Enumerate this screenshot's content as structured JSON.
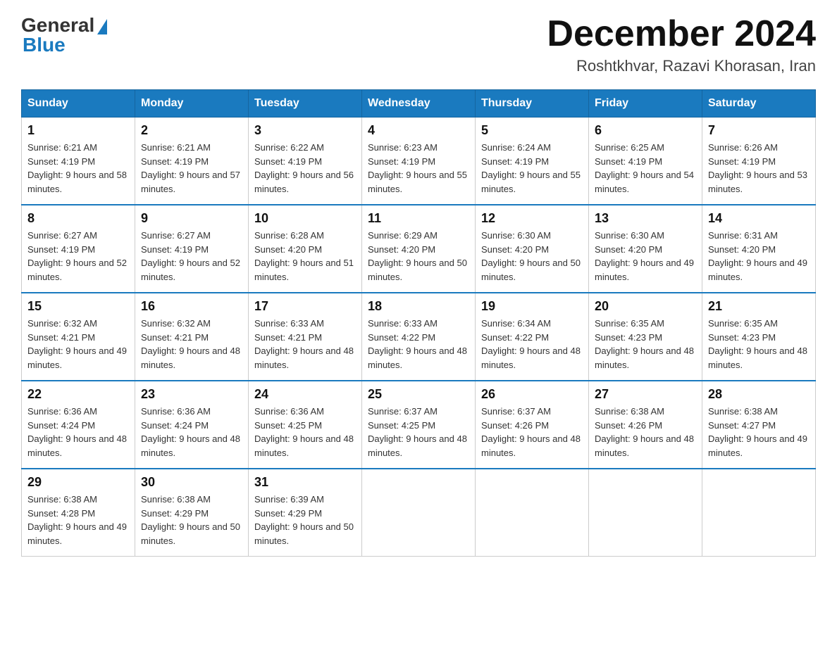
{
  "header": {
    "logo_general": "General",
    "logo_blue": "Blue",
    "month_title": "December 2024",
    "location": "Roshtkhvar, Razavi Khorasan, Iran"
  },
  "weekdays": [
    "Sunday",
    "Monday",
    "Tuesday",
    "Wednesday",
    "Thursday",
    "Friday",
    "Saturday"
  ],
  "weeks": [
    [
      {
        "day": "1",
        "sunrise": "6:21 AM",
        "sunset": "4:19 PM",
        "daylight": "9 hours and 58 minutes."
      },
      {
        "day": "2",
        "sunrise": "6:21 AM",
        "sunset": "4:19 PM",
        "daylight": "9 hours and 57 minutes."
      },
      {
        "day": "3",
        "sunrise": "6:22 AM",
        "sunset": "4:19 PM",
        "daylight": "9 hours and 56 minutes."
      },
      {
        "day": "4",
        "sunrise": "6:23 AM",
        "sunset": "4:19 PM",
        "daylight": "9 hours and 55 minutes."
      },
      {
        "day": "5",
        "sunrise": "6:24 AM",
        "sunset": "4:19 PM",
        "daylight": "9 hours and 55 minutes."
      },
      {
        "day": "6",
        "sunrise": "6:25 AM",
        "sunset": "4:19 PM",
        "daylight": "9 hours and 54 minutes."
      },
      {
        "day": "7",
        "sunrise": "6:26 AM",
        "sunset": "4:19 PM",
        "daylight": "9 hours and 53 minutes."
      }
    ],
    [
      {
        "day": "8",
        "sunrise": "6:27 AM",
        "sunset": "4:19 PM",
        "daylight": "9 hours and 52 minutes."
      },
      {
        "day": "9",
        "sunrise": "6:27 AM",
        "sunset": "4:19 PM",
        "daylight": "9 hours and 52 minutes."
      },
      {
        "day": "10",
        "sunrise": "6:28 AM",
        "sunset": "4:20 PM",
        "daylight": "9 hours and 51 minutes."
      },
      {
        "day": "11",
        "sunrise": "6:29 AM",
        "sunset": "4:20 PM",
        "daylight": "9 hours and 50 minutes."
      },
      {
        "day": "12",
        "sunrise": "6:30 AM",
        "sunset": "4:20 PM",
        "daylight": "9 hours and 50 minutes."
      },
      {
        "day": "13",
        "sunrise": "6:30 AM",
        "sunset": "4:20 PM",
        "daylight": "9 hours and 49 minutes."
      },
      {
        "day": "14",
        "sunrise": "6:31 AM",
        "sunset": "4:20 PM",
        "daylight": "9 hours and 49 minutes."
      }
    ],
    [
      {
        "day": "15",
        "sunrise": "6:32 AM",
        "sunset": "4:21 PM",
        "daylight": "9 hours and 49 minutes."
      },
      {
        "day": "16",
        "sunrise": "6:32 AM",
        "sunset": "4:21 PM",
        "daylight": "9 hours and 48 minutes."
      },
      {
        "day": "17",
        "sunrise": "6:33 AM",
        "sunset": "4:21 PM",
        "daylight": "9 hours and 48 minutes."
      },
      {
        "day": "18",
        "sunrise": "6:33 AM",
        "sunset": "4:22 PM",
        "daylight": "9 hours and 48 minutes."
      },
      {
        "day": "19",
        "sunrise": "6:34 AM",
        "sunset": "4:22 PM",
        "daylight": "9 hours and 48 minutes."
      },
      {
        "day": "20",
        "sunrise": "6:35 AM",
        "sunset": "4:23 PM",
        "daylight": "9 hours and 48 minutes."
      },
      {
        "day": "21",
        "sunrise": "6:35 AM",
        "sunset": "4:23 PM",
        "daylight": "9 hours and 48 minutes."
      }
    ],
    [
      {
        "day": "22",
        "sunrise": "6:36 AM",
        "sunset": "4:24 PM",
        "daylight": "9 hours and 48 minutes."
      },
      {
        "day": "23",
        "sunrise": "6:36 AM",
        "sunset": "4:24 PM",
        "daylight": "9 hours and 48 minutes."
      },
      {
        "day": "24",
        "sunrise": "6:36 AM",
        "sunset": "4:25 PM",
        "daylight": "9 hours and 48 minutes."
      },
      {
        "day": "25",
        "sunrise": "6:37 AM",
        "sunset": "4:25 PM",
        "daylight": "9 hours and 48 minutes."
      },
      {
        "day": "26",
        "sunrise": "6:37 AM",
        "sunset": "4:26 PM",
        "daylight": "9 hours and 48 minutes."
      },
      {
        "day": "27",
        "sunrise": "6:38 AM",
        "sunset": "4:26 PM",
        "daylight": "9 hours and 48 minutes."
      },
      {
        "day": "28",
        "sunrise": "6:38 AM",
        "sunset": "4:27 PM",
        "daylight": "9 hours and 49 minutes."
      }
    ],
    [
      {
        "day": "29",
        "sunrise": "6:38 AM",
        "sunset": "4:28 PM",
        "daylight": "9 hours and 49 minutes."
      },
      {
        "day": "30",
        "sunrise": "6:38 AM",
        "sunset": "4:29 PM",
        "daylight": "9 hours and 50 minutes."
      },
      {
        "day": "31",
        "sunrise": "6:39 AM",
        "sunset": "4:29 PM",
        "daylight": "9 hours and 50 minutes."
      },
      null,
      null,
      null,
      null
    ]
  ]
}
